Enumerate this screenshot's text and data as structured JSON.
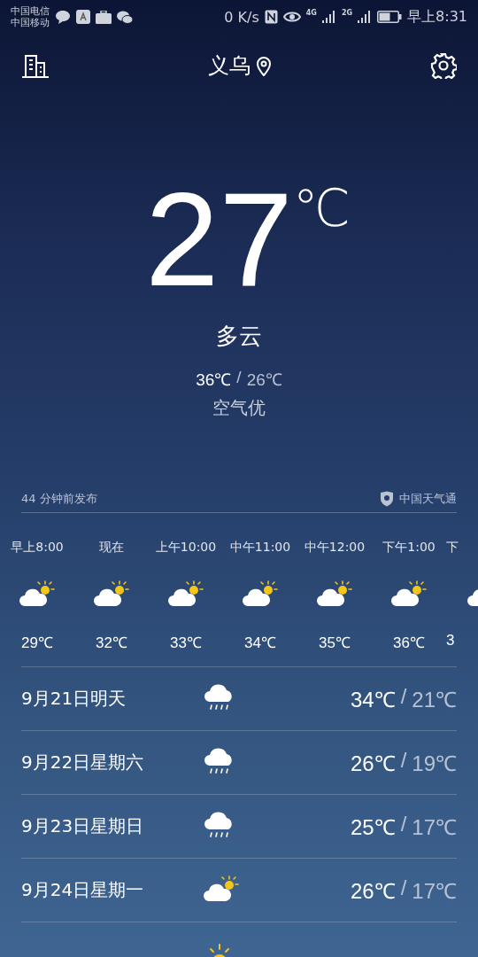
{
  "status_bar": {
    "carriers": [
      "中国电信",
      "中国移动"
    ],
    "speed": "0 K/s",
    "network_1": "4G",
    "network_2": "2G",
    "time": "早上8:31",
    "battery": {
      "level": 0.6
    }
  },
  "header": {
    "city": "义乌"
  },
  "current": {
    "temperature": "27",
    "unit": "℃",
    "condition": "多云",
    "high": "36℃",
    "low": "26℃",
    "separator": "/",
    "air_quality": "空气优"
  },
  "publish": {
    "time": "44 分钟前发布",
    "source": "中国天气通"
  },
  "hourly": [
    {
      "time": "早上8:00",
      "kind": "partly_cloudy",
      "temp": "29℃"
    },
    {
      "time": "现在",
      "kind": "partly_cloudy",
      "temp": "32℃"
    },
    {
      "time": "上午10:00",
      "kind": "partly_cloudy",
      "temp": "33℃"
    },
    {
      "time": "中午11:00",
      "kind": "partly_cloudy",
      "temp": "34℃"
    },
    {
      "time": "中午12:00",
      "kind": "partly_cloudy",
      "temp": "35℃"
    },
    {
      "time": "下午1:00",
      "kind": "partly_cloudy",
      "temp": "36℃"
    },
    {
      "time": "下",
      "kind": "partly_cloudy",
      "temp": "3"
    }
  ],
  "daily": [
    {
      "date": "9月21日明天",
      "kind": "rain",
      "high": "34℃",
      "separator": "/",
      "low": "21℃"
    },
    {
      "date": "9月22日星期六",
      "kind": "rain",
      "high": "26℃",
      "separator": "/",
      "low": "19℃"
    },
    {
      "date": "9月23日星期日",
      "kind": "rain",
      "high": "25℃",
      "separator": "/",
      "low": "17℃"
    },
    {
      "date": "9月24日星期一",
      "kind": "partly_cloudy",
      "high": "26℃",
      "separator": "/",
      "low": "17℃"
    },
    {
      "kind": "sunny"
    }
  ]
}
